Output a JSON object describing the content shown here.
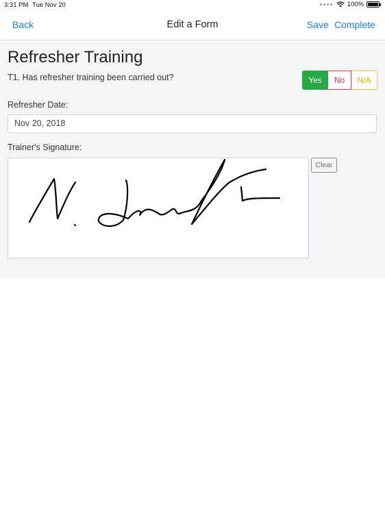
{
  "status_bar": {
    "time": "3:31 PM",
    "date": "Tue Nov 20",
    "battery": "100%"
  },
  "nav": {
    "back_label": "Back",
    "title": "Edit a Form",
    "save_label": "Save",
    "complete_label": "Complete"
  },
  "form": {
    "section_title": "Refresher Training",
    "question": "T1. Has refresher training been carried out?",
    "answer_options": {
      "yes": "Yes",
      "no": "No",
      "na": "N/A"
    },
    "selected_answer": "Yes",
    "date_label": "Refresher Date:",
    "date_value": "Nov 20, 2018",
    "signature_label": "Trainer's Signature:",
    "clear_label": "Clear"
  },
  "colors": {
    "accent": "#1a7fd6",
    "yes": "#28a745",
    "no": "#dc3545",
    "na": "#f0c24a"
  }
}
